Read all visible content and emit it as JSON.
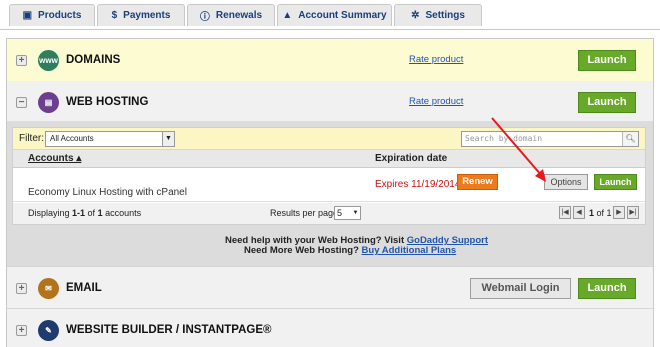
{
  "tabs": [
    {
      "label": "Products",
      "icon": "box-icon"
    },
    {
      "label": "Payments",
      "icon": "dollar-icon"
    },
    {
      "label": "Renewals",
      "icon": "info-icon"
    },
    {
      "label": "Account Summary",
      "icon": "person-icon"
    },
    {
      "label": "Settings",
      "icon": "gear-icon"
    }
  ],
  "products": {
    "domains": {
      "name": "DOMAINS",
      "icon_text": "www",
      "rate": "Rate product",
      "launch": "Launch",
      "expander": "+"
    },
    "hosting": {
      "name": "WEB HOSTING",
      "rate": "Rate product",
      "launch": "Launch",
      "expander": "−"
    },
    "email": {
      "name": "EMAIL",
      "webmail": "Webmail Login",
      "launch": "Launch",
      "expander": "+"
    },
    "builder": {
      "name": "WEBSITE BUILDER / INSTANTPAGE®",
      "expander": "+"
    }
  },
  "hosting_table": {
    "filter_label": "Filter:",
    "filter_value": "All Accounts",
    "search_placeholder": "Search by domain",
    "col_accounts": "Accounts ▴",
    "col_expiration": "Expiration date",
    "row": {
      "account": "Economy Linux Hosting with cPanel",
      "expires": "Expires 11/19/2014",
      "renew": "Renew",
      "options": "Options",
      "launch": "Launch"
    },
    "displaying_prefix": "Displaying ",
    "displaying_range": "1-1",
    "displaying_of": " of ",
    "displaying_total": "1",
    "displaying_suffix": " accounts",
    "results_per_page_label": "Results per page:",
    "results_per_page_value": "5",
    "page_prefix": "",
    "page_current": "1",
    "page_of": " of ",
    "page_total": "1"
  },
  "help": {
    "line1_text": "Need help with your Web Hosting? Visit ",
    "line1_link": "GoDaddy Support",
    "line2_text": "Need More Web Hosting? ",
    "line2_link": "Buy Additional Plans"
  },
  "colors": {
    "launch_green": "#68a929",
    "renew_orange": "#ee7a1e",
    "expires_red": "#cc1111",
    "arrow_red": "#e8191e"
  }
}
